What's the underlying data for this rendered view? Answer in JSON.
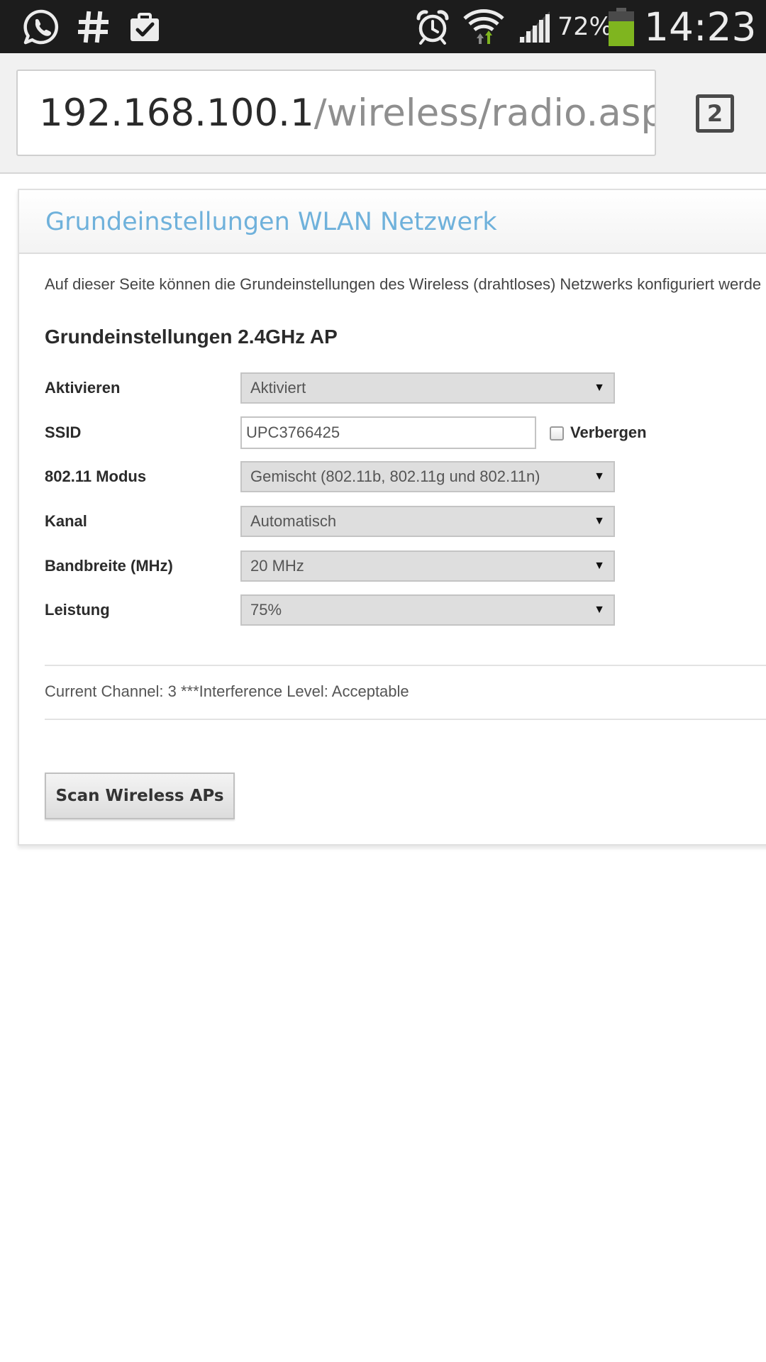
{
  "status_bar": {
    "icons_left": [
      "whatsapp-icon",
      "hashtag-icon",
      "clipboard-check-icon"
    ],
    "icons_right": [
      "alarm-icon",
      "wifi-icon",
      "signal-icon",
      "battery-icon"
    ],
    "battery_percent": "72%",
    "battery_level": 0.72,
    "battery_color": "#7fb51f",
    "time": "14:23"
  },
  "browser": {
    "url_host": "192.168.100.1",
    "url_path": "/wireless/radio.asp",
    "tab_count": "2"
  },
  "page": {
    "title": "Grundeinstellungen WLAN Netzwerk",
    "title_color": "#6fb1db",
    "description": "Auf dieser Seite können die Grundeinstellungen des Wireless (drahtloses) Netzwerks konfiguriert werde",
    "section_title": "Grundeinstellungen 2.4GHz AP",
    "fields": {
      "aktivieren": {
        "label": "Aktivieren",
        "value": "Aktiviert"
      },
      "ssid": {
        "label": "SSID",
        "value": "UPC3766425",
        "hide_label": "Verbergen",
        "hide_checked": false
      },
      "modus": {
        "label": "802.11 Modus",
        "value": "Gemischt (802.11b, 802.11g und 802.11n)"
      },
      "kanal": {
        "label": "Kanal",
        "value": "Automatisch"
      },
      "bandbreite": {
        "label": "Bandbreite (MHz)",
        "value": "20 MHz"
      },
      "leistung": {
        "label": "Leistung",
        "value": "75%"
      }
    },
    "status_text": "Current Channel: 3 ***Interference Level: Acceptable",
    "scan_button": "Scan Wireless APs"
  }
}
